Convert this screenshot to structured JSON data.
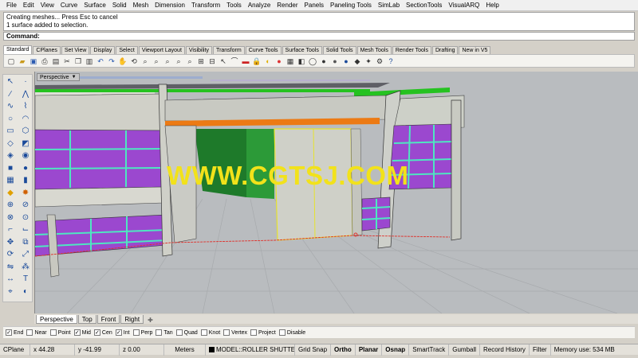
{
  "menu": [
    "File",
    "Edit",
    "View",
    "Curve",
    "Surface",
    "Solid",
    "Mesh",
    "Dimension",
    "Transform",
    "Tools",
    "Analyze",
    "Render",
    "Panels",
    "Paneling Tools",
    "SimLab",
    "SectionTools",
    "VisualARQ",
    "Help"
  ],
  "command_history": [
    "Creating meshes... Press Esc to cancel",
    "1 surface added to selection."
  ],
  "command_label": "Command:",
  "toolbar_tabs": [
    "Standard",
    "CPlanes",
    "Set View",
    "Display",
    "Select",
    "Viewport Layout",
    "Visibility",
    "Transform",
    "Curve Tools",
    "Surface Tools",
    "Solid Tools",
    "Mesh Tools",
    "Render Tools",
    "Drafting",
    "New in V5"
  ],
  "viewport": {
    "label": "Perspective",
    "watermark": "WWW.CGTSJ.COM"
  },
  "viewport_tabs": [
    "Perspective",
    "Top",
    "Front",
    "Right"
  ],
  "osnaps": [
    {
      "label": "End",
      "checked": true
    },
    {
      "label": "Near",
      "checked": false
    },
    {
      "label": "Point",
      "checked": false
    },
    {
      "label": "Mid",
      "checked": true
    },
    {
      "label": "Cen",
      "checked": true
    },
    {
      "label": "Int",
      "checked": true
    },
    {
      "label": "Perp",
      "checked": false
    },
    {
      "label": "Tan",
      "checked": false
    },
    {
      "label": "Quad",
      "checked": false
    },
    {
      "label": "Knot",
      "checked": false
    },
    {
      "label": "Vertex",
      "checked": false
    },
    {
      "label": "Project",
      "checked": false
    },
    {
      "label": "Disable",
      "checked": false
    }
  ],
  "status": {
    "cplane": "CPlane",
    "x": "x 44.28",
    "y": "y -41.99",
    "z": "z 0.00",
    "units": "Meters",
    "layer": "MODEL::ROLLER SHUTTEF",
    "grid_snap": "Grid Snap",
    "ortho": "Ortho",
    "planar": "Planar",
    "osnap": "Osnap",
    "smarttrack": "SmartTrack",
    "gumball": "Gumball",
    "record_history": "Record History",
    "filter": "Filter",
    "memory": "Memory use: 534 MB"
  },
  "colors": {
    "window_panel": "#9b48cf",
    "mullion": "#4ee7c0",
    "roof_edge": "#25c220",
    "beam": "#ec7a14",
    "selection": "#e6e22e",
    "watermark": "#f2e21a",
    "background": "#b9bcbf"
  }
}
